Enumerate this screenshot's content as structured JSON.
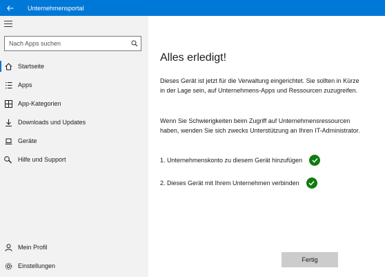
{
  "titlebar": {
    "back_icon": "back-arrow-icon",
    "title": "Unternehmensportal"
  },
  "sidebar": {
    "menu_icon": "hamburger-icon",
    "search": {
      "placeholder": "Nach Apps suchen",
      "value": "",
      "icon": "search-icon"
    },
    "items": [
      {
        "label": "Startseite",
        "icon": "home-icon",
        "active": true
      },
      {
        "label": "Apps",
        "icon": "apps-list-icon"
      },
      {
        "label": "App-Kategorien",
        "icon": "grid-icon"
      },
      {
        "label": "Downloads und Updates",
        "icon": "download-icon"
      },
      {
        "label": "Geräte",
        "icon": "laptop-icon"
      },
      {
        "label": "Hilfe und Support",
        "icon": "help-icon"
      }
    ],
    "bottom_items": [
      {
        "label": "Mein Profil",
        "icon": "person-icon"
      },
      {
        "label": "Einstellungen",
        "icon": "gear-icon"
      }
    ]
  },
  "main": {
    "heading": "Alles erledigt!",
    "paragraph1": "Dieses Gerät ist jetzt für die Verwaltung eingerichtet. Sie sollten in Kürze in der Lage sein, auf Unternehmens-Apps und Ressourcen zuzugreifen.",
    "paragraph2": "Wenn Sie Schwierigkeiten beim Zugriff auf Unternehmensressourcen haben, wenden Sie sich zwecks Unterstützung an Ihren IT-Administrator.",
    "steps": [
      {
        "label": "1. Unternehmenskonto zu diesem Gerät hinzufügen",
        "status": "done"
      },
      {
        "label": "2. Dieses Gerät mit Ihrem Unternehmen verbinden",
        "status": "done"
      }
    ],
    "done_button": "Fertig"
  },
  "colors": {
    "accent": "#0078d7",
    "success": "#107c10",
    "sidebar_bg": "#f2f2f2",
    "button_bg": "#cccccc"
  }
}
